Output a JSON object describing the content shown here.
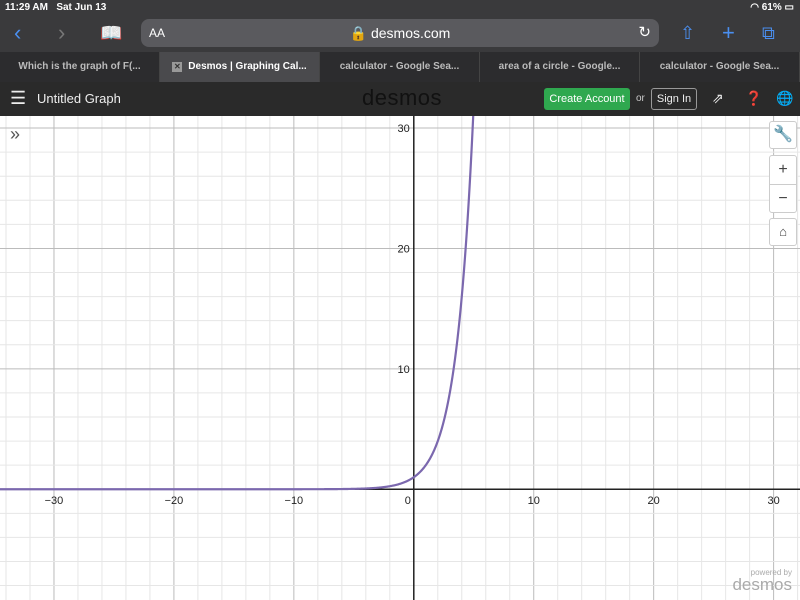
{
  "status": {
    "time": "11:29 AM",
    "date": "Sat Jun 13",
    "battery": "61%"
  },
  "browser": {
    "text_size": "AA",
    "url": "desmos.com",
    "tabs": [
      {
        "label": "Which is the graph of F(...",
        "active": false
      },
      {
        "label": "Desmos | Graphing Cal...",
        "active": true
      },
      {
        "label": "calculator - Google Sea...",
        "active": false
      },
      {
        "label": "area of a circle - Google...",
        "active": false
      },
      {
        "label": "calculator - Google Sea...",
        "active": false
      }
    ]
  },
  "header": {
    "title": "Untitled Graph",
    "logo": "desmos",
    "create_account": "Create Account",
    "or": "or",
    "sign_in": "Sign In"
  },
  "controls": {
    "zoom_in": "+",
    "zoom_out": "−"
  },
  "footer": {
    "powered": "powered by",
    "brand": "desmos"
  },
  "chart_data": {
    "type": "line",
    "expression": "y = 2^x",
    "xlim": [
      -34.5,
      32.2
    ],
    "ylim": [
      -9.2,
      31
    ],
    "x_ticks": [
      -30,
      -20,
      -10,
      0,
      10,
      20,
      30
    ],
    "y_ticks": [
      10,
      20,
      30
    ],
    "grid": true,
    "minor_step": 2,
    "series": [
      {
        "color": "#7b68ae"
      }
    ]
  }
}
